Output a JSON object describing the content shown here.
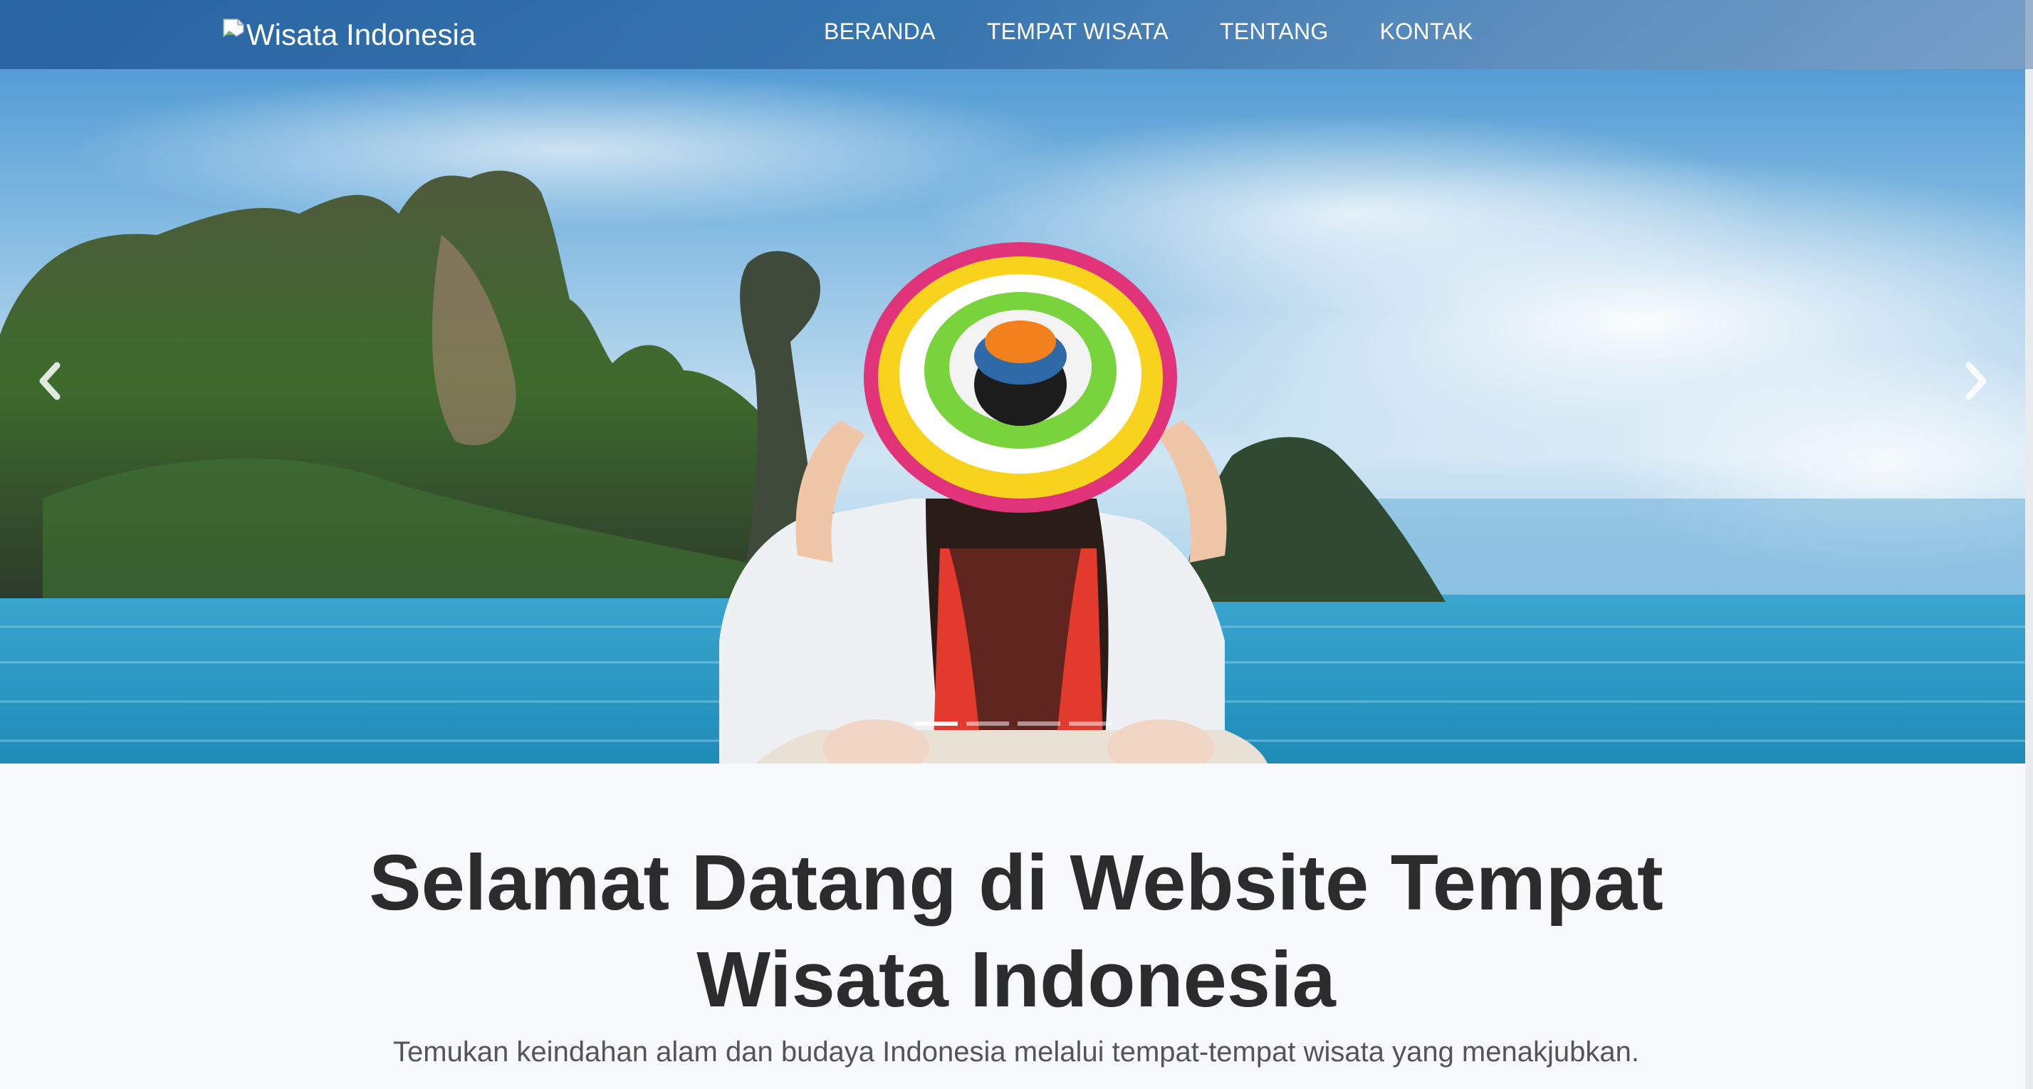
{
  "navbar": {
    "brand": "Wisata Indonesia",
    "links": [
      {
        "label": "BERANDA"
      },
      {
        "label": "TEMPAT WISATA"
      },
      {
        "label": "TENTANG"
      },
      {
        "label": "KONTAK"
      }
    ]
  },
  "carousel": {
    "slide_count": 4,
    "active_slide": 1,
    "prev_icon": "chevron-left-icon",
    "next_icon": "chevron-right-icon"
  },
  "welcome": {
    "title": "Selamat Datang di Website Tempat Wisata Indonesia",
    "subtitle": "Temukan keindahan alam dan budaya Indonesia melalui tempat-tempat wisata yang menakjubkan."
  },
  "colors": {
    "navbar": "#2f6aa5",
    "title_text": "#2c2c2c",
    "subtitle_text": "#555555",
    "page_bg": "#f8f9fa"
  }
}
